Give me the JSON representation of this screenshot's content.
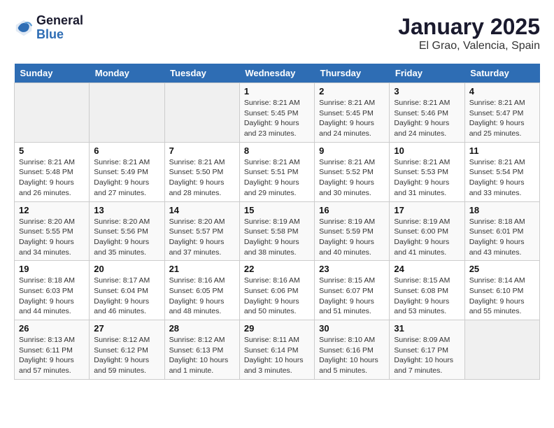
{
  "logo": {
    "line1": "General",
    "line2": "Blue"
  },
  "title": "January 2025",
  "subtitle": "El Grao, Valencia, Spain",
  "days_of_week": [
    "Sunday",
    "Monday",
    "Tuesday",
    "Wednesday",
    "Thursday",
    "Friday",
    "Saturday"
  ],
  "weeks": [
    [
      {
        "day": "",
        "info": ""
      },
      {
        "day": "",
        "info": ""
      },
      {
        "day": "",
        "info": ""
      },
      {
        "day": "1",
        "info": "Sunrise: 8:21 AM\nSunset: 5:45 PM\nDaylight: 9 hours and 23 minutes."
      },
      {
        "day": "2",
        "info": "Sunrise: 8:21 AM\nSunset: 5:45 PM\nDaylight: 9 hours and 24 minutes."
      },
      {
        "day": "3",
        "info": "Sunrise: 8:21 AM\nSunset: 5:46 PM\nDaylight: 9 hours and 24 minutes."
      },
      {
        "day": "4",
        "info": "Sunrise: 8:21 AM\nSunset: 5:47 PM\nDaylight: 9 hours and 25 minutes."
      }
    ],
    [
      {
        "day": "5",
        "info": "Sunrise: 8:21 AM\nSunset: 5:48 PM\nDaylight: 9 hours and 26 minutes."
      },
      {
        "day": "6",
        "info": "Sunrise: 8:21 AM\nSunset: 5:49 PM\nDaylight: 9 hours and 27 minutes."
      },
      {
        "day": "7",
        "info": "Sunrise: 8:21 AM\nSunset: 5:50 PM\nDaylight: 9 hours and 28 minutes."
      },
      {
        "day": "8",
        "info": "Sunrise: 8:21 AM\nSunset: 5:51 PM\nDaylight: 9 hours and 29 minutes."
      },
      {
        "day": "9",
        "info": "Sunrise: 8:21 AM\nSunset: 5:52 PM\nDaylight: 9 hours and 30 minutes."
      },
      {
        "day": "10",
        "info": "Sunrise: 8:21 AM\nSunset: 5:53 PM\nDaylight: 9 hours and 31 minutes."
      },
      {
        "day": "11",
        "info": "Sunrise: 8:21 AM\nSunset: 5:54 PM\nDaylight: 9 hours and 33 minutes."
      }
    ],
    [
      {
        "day": "12",
        "info": "Sunrise: 8:20 AM\nSunset: 5:55 PM\nDaylight: 9 hours and 34 minutes."
      },
      {
        "day": "13",
        "info": "Sunrise: 8:20 AM\nSunset: 5:56 PM\nDaylight: 9 hours and 35 minutes."
      },
      {
        "day": "14",
        "info": "Sunrise: 8:20 AM\nSunset: 5:57 PM\nDaylight: 9 hours and 37 minutes."
      },
      {
        "day": "15",
        "info": "Sunrise: 8:19 AM\nSunset: 5:58 PM\nDaylight: 9 hours and 38 minutes."
      },
      {
        "day": "16",
        "info": "Sunrise: 8:19 AM\nSunset: 5:59 PM\nDaylight: 9 hours and 40 minutes."
      },
      {
        "day": "17",
        "info": "Sunrise: 8:19 AM\nSunset: 6:00 PM\nDaylight: 9 hours and 41 minutes."
      },
      {
        "day": "18",
        "info": "Sunrise: 8:18 AM\nSunset: 6:01 PM\nDaylight: 9 hours and 43 minutes."
      }
    ],
    [
      {
        "day": "19",
        "info": "Sunrise: 8:18 AM\nSunset: 6:03 PM\nDaylight: 9 hours and 44 minutes."
      },
      {
        "day": "20",
        "info": "Sunrise: 8:17 AM\nSunset: 6:04 PM\nDaylight: 9 hours and 46 minutes."
      },
      {
        "day": "21",
        "info": "Sunrise: 8:16 AM\nSunset: 6:05 PM\nDaylight: 9 hours and 48 minutes."
      },
      {
        "day": "22",
        "info": "Sunrise: 8:16 AM\nSunset: 6:06 PM\nDaylight: 9 hours and 50 minutes."
      },
      {
        "day": "23",
        "info": "Sunrise: 8:15 AM\nSunset: 6:07 PM\nDaylight: 9 hours and 51 minutes."
      },
      {
        "day": "24",
        "info": "Sunrise: 8:15 AM\nSunset: 6:08 PM\nDaylight: 9 hours and 53 minutes."
      },
      {
        "day": "25",
        "info": "Sunrise: 8:14 AM\nSunset: 6:10 PM\nDaylight: 9 hours and 55 minutes."
      }
    ],
    [
      {
        "day": "26",
        "info": "Sunrise: 8:13 AM\nSunset: 6:11 PM\nDaylight: 9 hours and 57 minutes."
      },
      {
        "day": "27",
        "info": "Sunrise: 8:12 AM\nSunset: 6:12 PM\nDaylight: 9 hours and 59 minutes."
      },
      {
        "day": "28",
        "info": "Sunrise: 8:12 AM\nSunset: 6:13 PM\nDaylight: 10 hours and 1 minute."
      },
      {
        "day": "29",
        "info": "Sunrise: 8:11 AM\nSunset: 6:14 PM\nDaylight: 10 hours and 3 minutes."
      },
      {
        "day": "30",
        "info": "Sunrise: 8:10 AM\nSunset: 6:16 PM\nDaylight: 10 hours and 5 minutes."
      },
      {
        "day": "31",
        "info": "Sunrise: 8:09 AM\nSunset: 6:17 PM\nDaylight: 10 hours and 7 minutes."
      },
      {
        "day": "",
        "info": ""
      }
    ]
  ]
}
